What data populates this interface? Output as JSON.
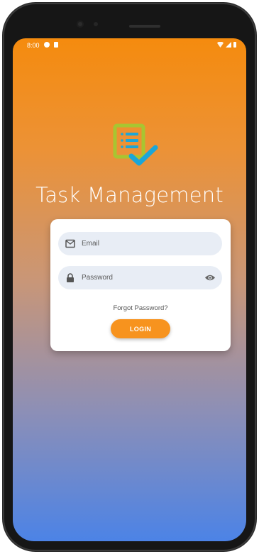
{
  "status_bar": {
    "time": "8:00"
  },
  "app": {
    "title": "Task Management",
    "logo_icon": "task-checklist-icon"
  },
  "login_form": {
    "email": {
      "placeholder": "Email",
      "value": "",
      "icon": "envelope-icon"
    },
    "password": {
      "placeholder": "Password",
      "value": "",
      "icon": "lock-icon",
      "toggle_icon": "eye-icon"
    },
    "forgot_password_label": "Forgot Password?",
    "login_label": "LOGIN"
  },
  "colors": {
    "gradient_top": "#f58b0e",
    "gradient_bottom": "#4c83e6",
    "accent": "#f7931e",
    "field_bg": "#e8edf5",
    "logo_green": "#a8c531",
    "logo_blue": "#1ba6d8"
  }
}
